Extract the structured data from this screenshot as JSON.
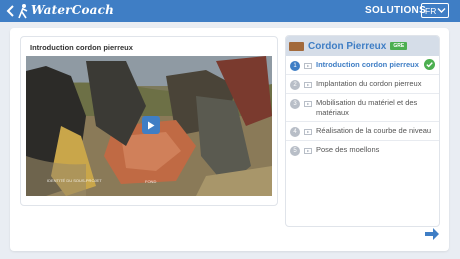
{
  "app": {
    "brand": "WaterCoach",
    "nav_label": "SOLUTIONS",
    "language": "FR",
    "colors": {
      "primary": "#3f7ec5",
      "success": "#4caf50"
    }
  },
  "video": {
    "title": "Introduction cordon pierreux",
    "watermark_left": "IDENTITÉ DU SOUS-PROJET",
    "watermark_right": "FOND"
  },
  "lesson": {
    "title": "Cordon Pierreux",
    "badge": "GRE",
    "steps": [
      {
        "number": "1",
        "label": "Introduction cordon pierreux",
        "active": true,
        "completed": true
      },
      {
        "number": "2",
        "label": "Implantation du cordon pierreux"
      },
      {
        "number": "3",
        "label": "Mobilisation du matériel et des matériaux"
      },
      {
        "number": "4",
        "label": "Réalisation de la courbe de niveau"
      },
      {
        "number": "5",
        "label": "Pose des moellons"
      }
    ]
  },
  "icons": {
    "back": "chevron-left-icon",
    "logo": "figure-icon",
    "language_dropdown": "chevron-down-icon",
    "play": "play-icon",
    "video_step": "video-icon",
    "completed": "check-circle-icon",
    "next": "arrow-right-icon"
  }
}
